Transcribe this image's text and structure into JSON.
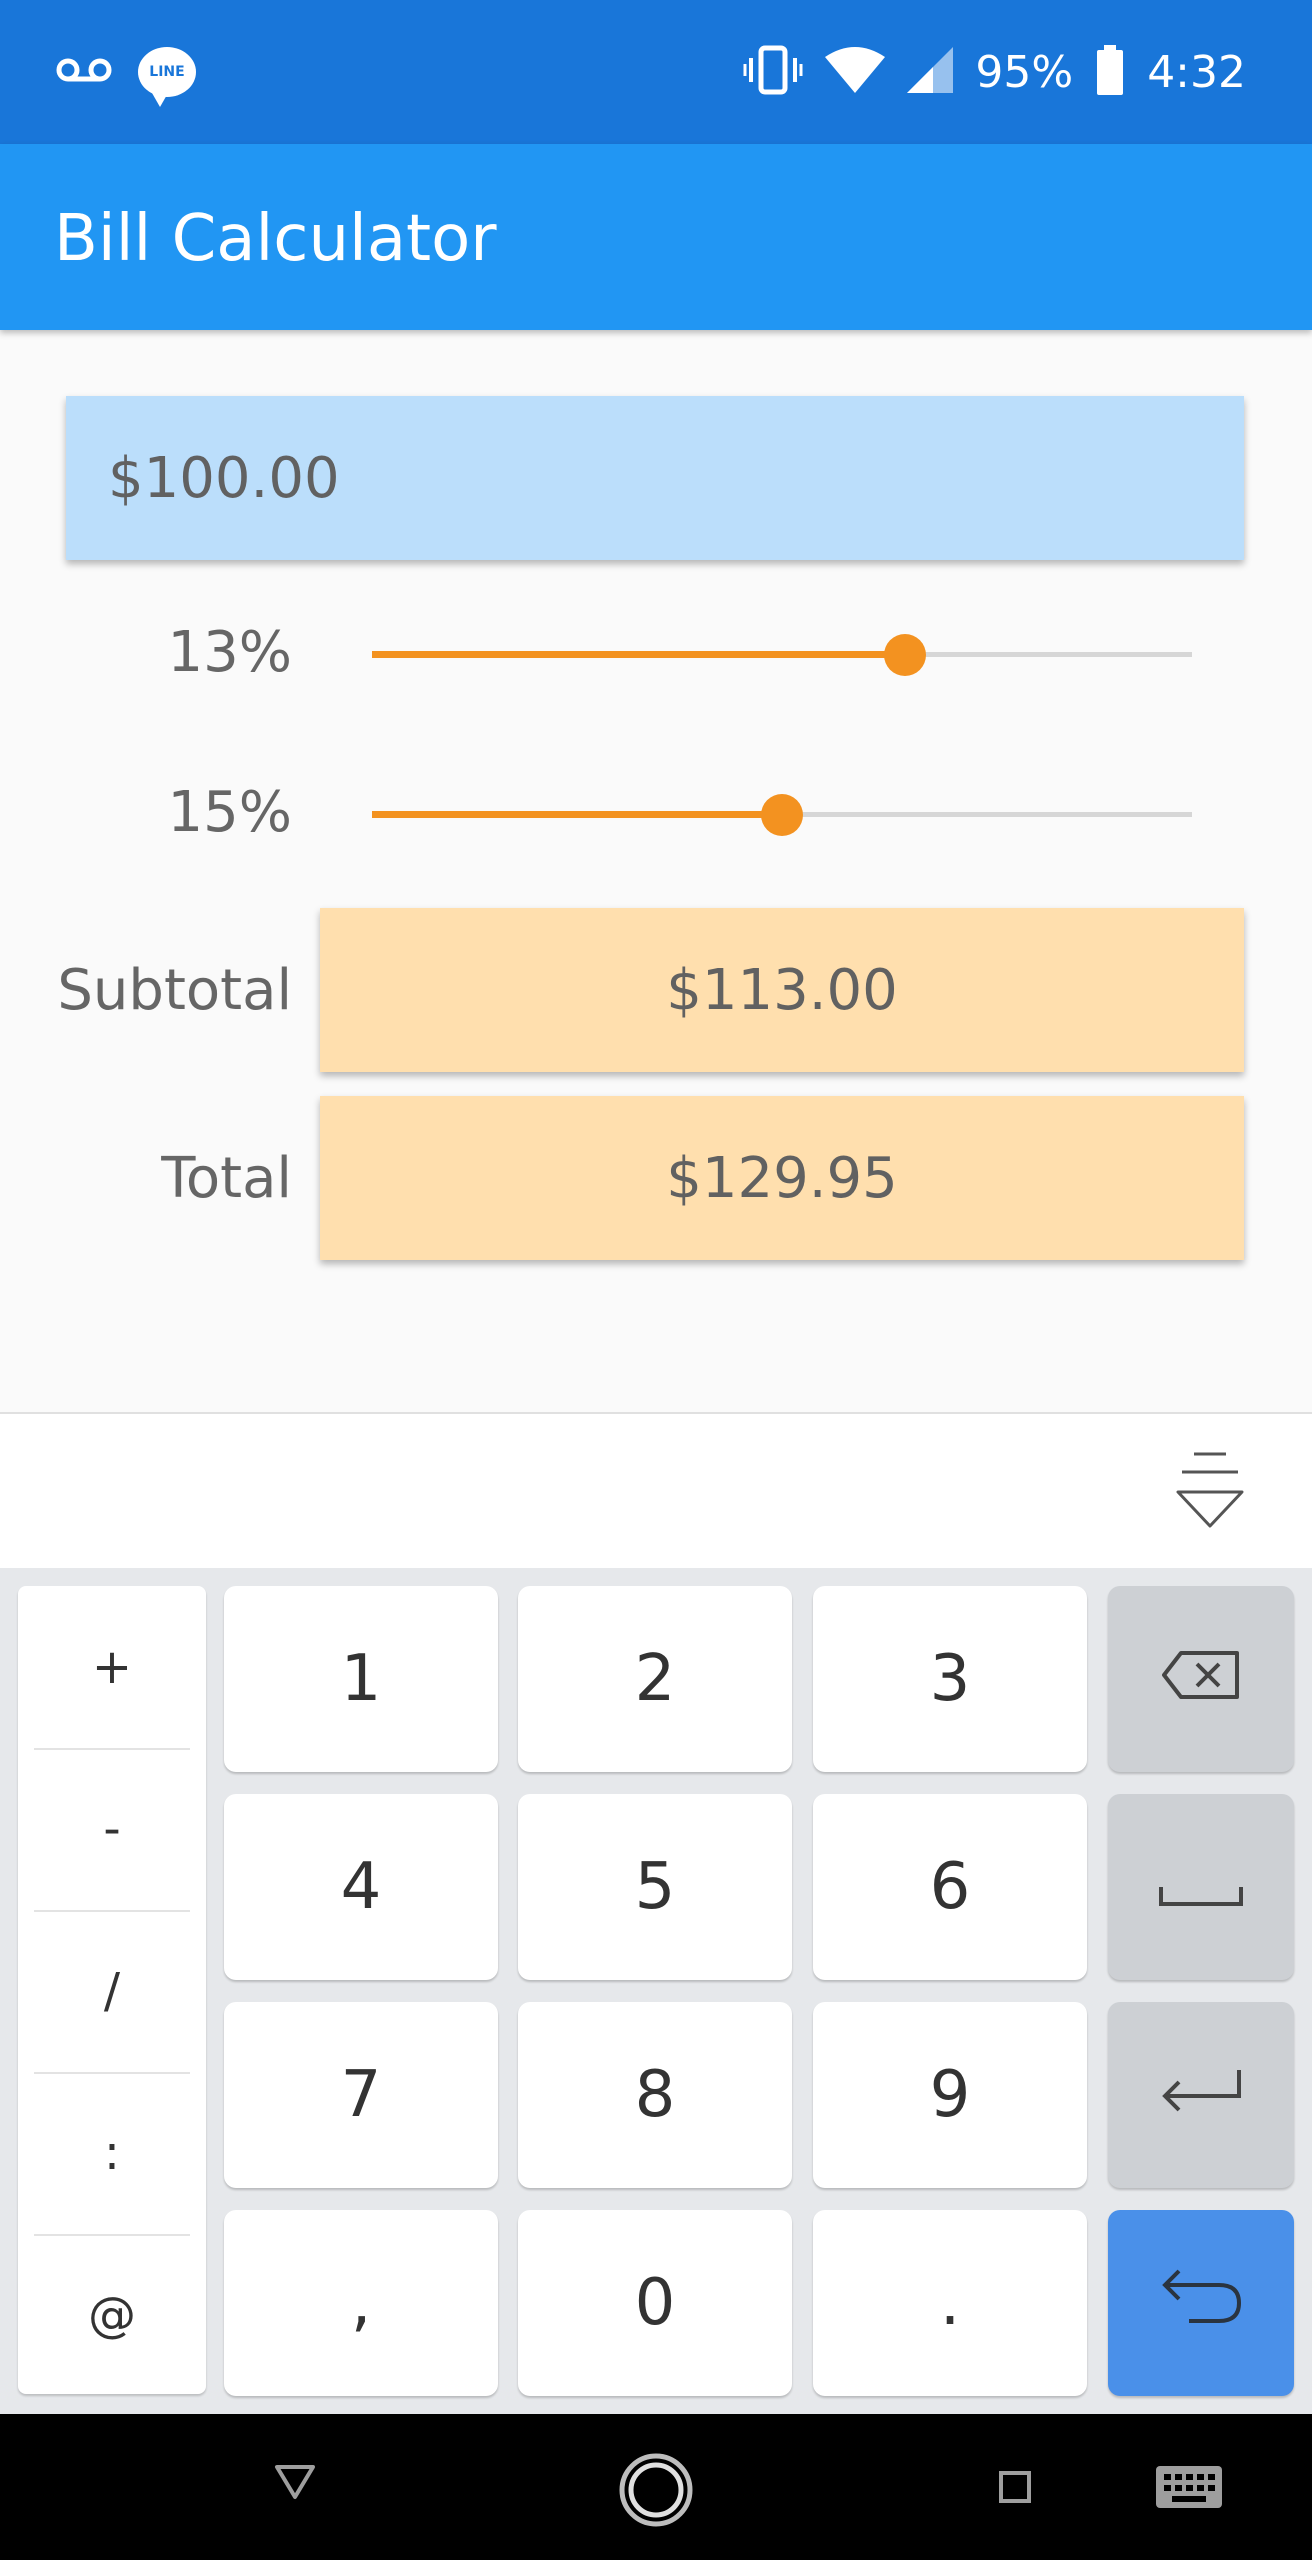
{
  "status_bar": {
    "battery": "95%",
    "time": "4:32",
    "icons": [
      "voicemail-icon",
      "line-app-icon",
      "vibrate-icon",
      "wifi-icon",
      "signal-icon",
      "battery-icon"
    ],
    "line_logo": "LINE"
  },
  "app_bar": {
    "title": "Bill Calculator"
  },
  "form": {
    "amount": "$100.00",
    "tax": {
      "label": "13%",
      "value_percent": 13,
      "fill_fraction": 0.65
    },
    "tip": {
      "label": "15%",
      "value_percent": 15,
      "fill_fraction": 0.5
    },
    "subtotal": {
      "label": "Subtotal",
      "value": "$113.00"
    },
    "total": {
      "label": "Total",
      "value": "$129.95"
    }
  },
  "keyboard": {
    "symbols": [
      "+",
      "-",
      "/",
      ":",
      "@"
    ],
    "digits_row1": [
      "1",
      "2",
      "3"
    ],
    "digits_row2": [
      "4",
      "5",
      "6"
    ],
    "digits_row3": [
      "7",
      "8",
      "9"
    ],
    "bottom_row": [
      ",",
      "0",
      "."
    ],
    "function_keys": [
      "backspace-icon",
      "space-icon",
      "enter-icon",
      "done-icon"
    ]
  },
  "nav_bar": {
    "icons": [
      "back-icon",
      "home-icon",
      "recents-icon",
      "keyboard-icon"
    ]
  },
  "colors": {
    "status_bar": "#1976d9",
    "app_bar": "#2196f3",
    "amount_field": "#bbdefb",
    "result_box": "#ffdfae",
    "slider_accent": "#f39220",
    "done_key": "#4a90e9"
  }
}
